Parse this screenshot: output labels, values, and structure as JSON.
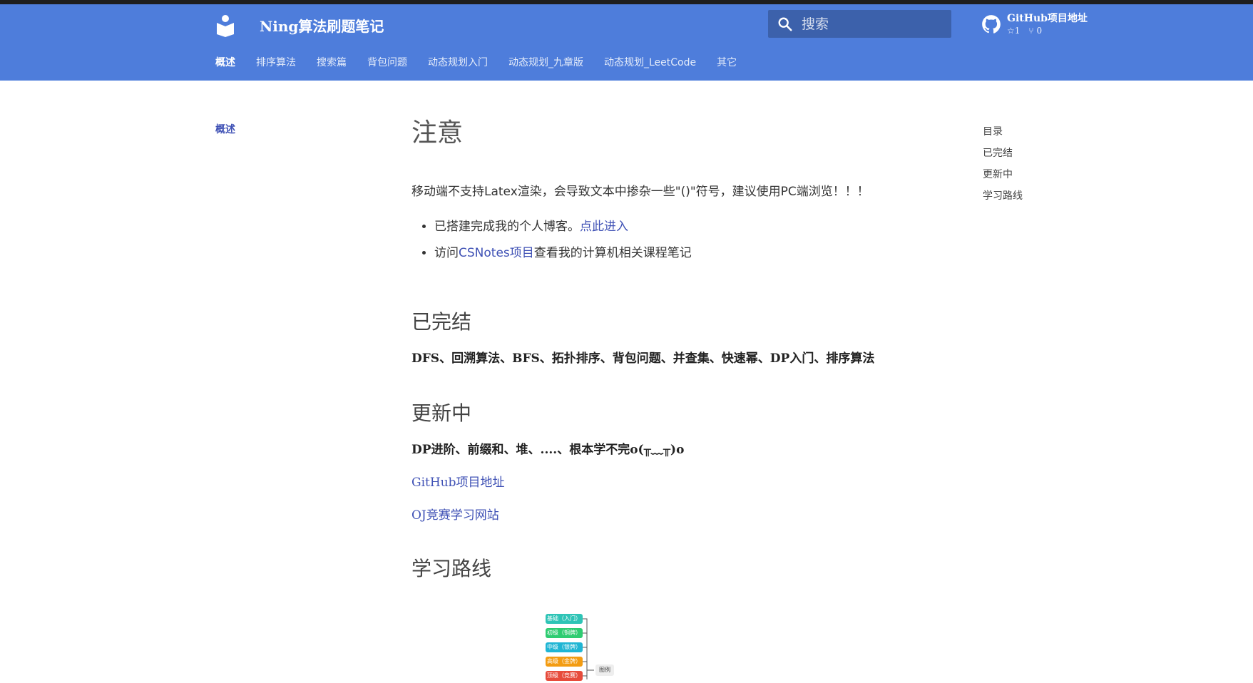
{
  "header": {
    "site_title": "Ning算法刷题笔记",
    "search_placeholder": "搜索",
    "repo_name": "GitHub项目地址",
    "stars": "1",
    "forks": "0",
    "color": "#4e7ddb"
  },
  "tabs": [
    {
      "label": "概述",
      "active": true
    },
    {
      "label": "排序算法"
    },
    {
      "label": "搜索篇"
    },
    {
      "label": "背包问题"
    },
    {
      "label": "动态规划入门"
    },
    {
      "label": "动态规划_九章版"
    },
    {
      "label": "动态规划_LeetCode"
    },
    {
      "label": "其它"
    }
  ],
  "left_nav": {
    "items": [
      "概述"
    ]
  },
  "toc": {
    "items": [
      "目录",
      "已完结",
      "更新中",
      "学习路线"
    ]
  },
  "content": {
    "title": "注意",
    "intro": "移动端不支持Latex渲染，会导致文本中掺杂一些\"()\"符号，建议使用PC端浏览！！！",
    "bullet1_prefix": "已搭建完成我的个人博客。",
    "bullet1_link": "点此进入",
    "bullet2_prefix": "访问",
    "bullet2_link": "CSNotes项目",
    "bullet2_suffix": "查看我的计算机相关课程笔记",
    "section_done": "已完结",
    "done_text": "DFS、回溯算法、BFS、拓扑排序、背包问题、并查集、快速幂、DP入门、排序算法",
    "section_updating": "更新中",
    "updating_text": "DP进阶、前缀和、堆、....、根本学不完o(╥﹏╥)o",
    "github_link": "GitHub项目地址",
    "oj_link": "OJ竞赛学习网站",
    "section_roadmap": "学习路线"
  },
  "roadmap": {
    "nodes": [
      {
        "label": "基础（入门）",
        "color": "#2ec4b6"
      },
      {
        "label": "初级（铜牌）",
        "color": "#2ecc71"
      },
      {
        "label": "中级（银牌）",
        "color": "#1fb5d4"
      },
      {
        "label": "高级（金牌）",
        "color": "#f39c12"
      },
      {
        "label": "顶级（竞赛）",
        "color": "#e74c3c"
      }
    ],
    "legend": "图例"
  }
}
